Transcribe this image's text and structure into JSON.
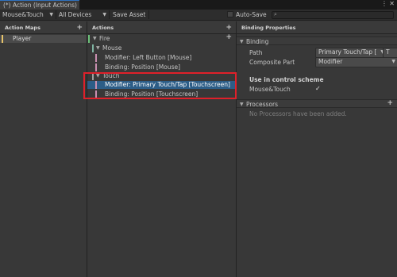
{
  "window": {
    "tab_title": "(*) Action (Input Actions)",
    "menu_icon": "kebab-menu-icon",
    "close_icon": "close-icon"
  },
  "toolbar": {
    "scheme_value": "Mouse&Touch",
    "devices_value": "All Devices",
    "save_label": "Save Asset",
    "autosave_label": "Auto-Save",
    "autosave_checked": false,
    "search_value": ""
  },
  "action_maps": {
    "header": "Action Maps",
    "items": [
      {
        "label": "Player",
        "color": "#e6c36a",
        "selected": true
      }
    ]
  },
  "actions": {
    "header": "Actions",
    "rows": [
      {
        "label": "Fire",
        "indent": 0,
        "expanded": true,
        "color": "#6cc17a",
        "has_add": true
      },
      {
        "label": "Mouse",
        "indent": 1,
        "expanded": true,
        "color": "#7fb4a2"
      },
      {
        "label": "Modifier: Left Button [Mouse]",
        "indent": 2,
        "color": "#c98fb0"
      },
      {
        "label": "Binding: Position [Mouse]",
        "indent": 2,
        "color": "#c98fb0"
      },
      {
        "label": "Touch",
        "indent": 1,
        "expanded": true,
        "color": "#9f9f9f"
      },
      {
        "label": "Modifier: Primary Touch/Tap [Touchscreen]",
        "indent": 2,
        "color": "#c98fb0",
        "selected": true
      },
      {
        "label": "Binding: Position [Touchscreen]",
        "indent": 2,
        "color": "#c98fb0"
      }
    ]
  },
  "properties": {
    "header": "Binding Properties",
    "binding_section": "Binding",
    "path_label": "Path",
    "path_value": "Primary Touch/Tap [",
    "path_t_button": "T",
    "composite_label": "Composite Part",
    "composite_value": "Modifier",
    "scheme_heading": "Use in control scheme",
    "scheme_item": "Mouse&Touch",
    "scheme_checked": true,
    "processors_section": "Processors",
    "processors_empty": "No Processors have been added."
  },
  "colors": {
    "selection": "#2c5d87",
    "highlight_box": "#e0202a"
  }
}
